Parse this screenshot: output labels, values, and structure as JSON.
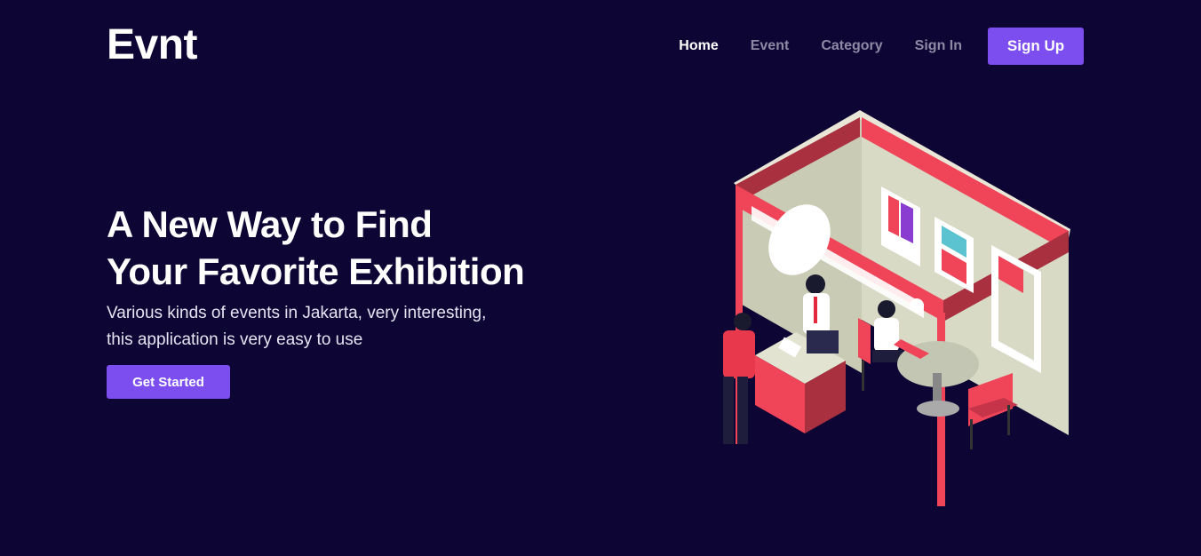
{
  "brand": {
    "name": "Evnt"
  },
  "nav": {
    "items": [
      {
        "label": "Home",
        "active": true
      },
      {
        "label": "Event",
        "active": false
      },
      {
        "label": "Category",
        "active": false
      },
      {
        "label": "Sign In",
        "active": false
      }
    ],
    "signup_label": "Sign Up"
  },
  "hero": {
    "title_line1": "A New Way to Find",
    "title_line2": "Your Favorite Exhibition",
    "subtitle_line1": "Various kinds of events in Jakarta, very interesting,",
    "subtitle_line2": "this application is very easy to use",
    "cta_label": "Get Started"
  },
  "colors": {
    "background": "#0d0533",
    "accent": "#7c4ef0",
    "booth_red": "#f04458",
    "booth_wall": "#d6d8c4"
  },
  "illustration": {
    "icon": "exhibition-booth-illustration"
  }
}
